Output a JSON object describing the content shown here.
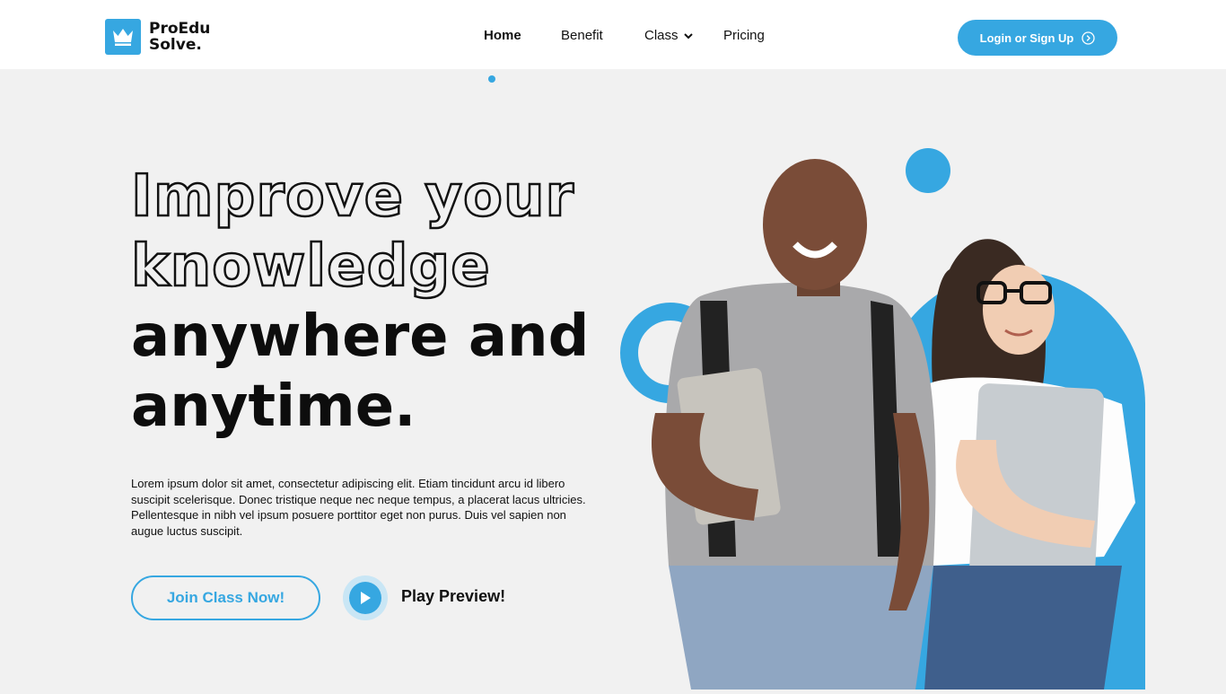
{
  "brand": {
    "line1": "ProEdu",
    "line2": "Solve.",
    "logo_icon": "crown-icon",
    "accent_color": "#36a7e1"
  },
  "nav": {
    "items": [
      {
        "label": "Home",
        "active": true
      },
      {
        "label": "Benefit",
        "active": false
      },
      {
        "label": "Class",
        "active": false,
        "has_dropdown": true
      },
      {
        "label": "Pricing",
        "active": false
      }
    ],
    "login_label": "Login or Sign Up",
    "login_icon": "arrow-right-circle-icon"
  },
  "hero": {
    "title_outline_1": "Improve your",
    "title_outline_2": "knowledge",
    "title_solid_1": "anywhere and",
    "title_solid_2": "anytime.",
    "description": "Lorem ipsum dolor sit amet, consectetur adipiscing elit. Etiam tincidunt arcu id libero suscipit scelerisque. Donec tristique neque nec neque tempus, a placerat lacus ultricies. Pellentesque in nibh vel ipsum posuere porttitor eget non purus. Duis vel sapien non augue luctus suscipit.",
    "join_label": "Join Class Now!",
    "play_label": "Play Preview!",
    "play_icon": "play-icon"
  }
}
